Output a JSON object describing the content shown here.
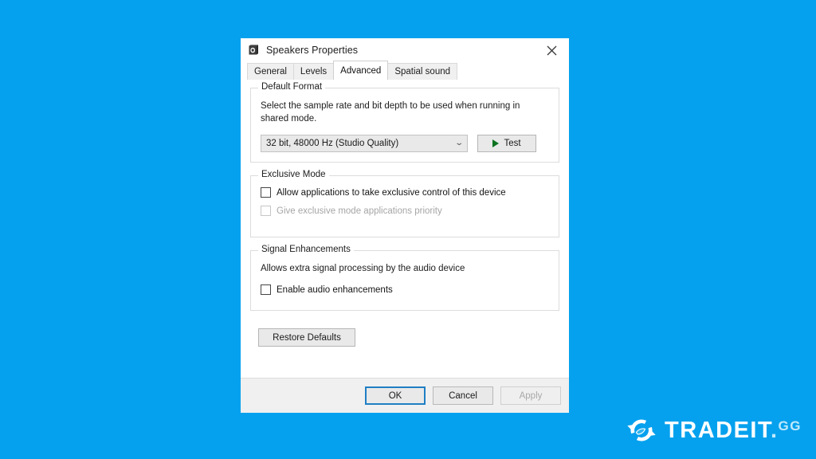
{
  "background_color": "#06a1ee",
  "dialog": {
    "titlebar": {
      "icon": "speaker-icon",
      "title": "Speakers Properties",
      "close_label": "✕"
    },
    "tabs": [
      {
        "label": "General",
        "active": false
      },
      {
        "label": "Levels",
        "active": false
      },
      {
        "label": "Advanced",
        "active": true
      },
      {
        "label": "Spatial sound",
        "active": false
      }
    ],
    "groups": [
      {
        "id": "default-format",
        "title": "Default Format",
        "description": "Select the sample rate and bit depth to be used when running in shared mode.",
        "combo": {
          "value": "32 bit, 48000 Hz (Studio Quality)",
          "chevron": "⌄"
        },
        "test_button": {
          "label": "Test",
          "icon": "play-icon",
          "icon_color": "#0c7320"
        }
      },
      {
        "id": "exclusive-mode",
        "title": "Exclusive Mode",
        "checkboxes": [
          {
            "label": "Allow applications to take exclusive control of this device",
            "checked": false,
            "disabled": false
          },
          {
            "label": "Give exclusive mode applications priority",
            "checked": false,
            "disabled": true
          }
        ]
      },
      {
        "id": "signal-enhancements",
        "title": "Signal Enhancements",
        "description": "Allows extra signal processing by the audio device",
        "checkboxes": [
          {
            "label": "Enable audio enhancements",
            "checked": false,
            "disabled": false
          }
        ]
      }
    ],
    "restore_button": {
      "label": "Restore Defaults"
    },
    "footer_buttons": [
      {
        "label": "OK",
        "default": true,
        "disabled": false
      },
      {
        "label": "Cancel",
        "default": false,
        "disabled": false
      },
      {
        "label": "Apply",
        "default": false,
        "disabled": true
      }
    ]
  },
  "watermark": {
    "mark_icon": "tradeit-circular-arrow-logo",
    "text_primary": "TRADE",
    "text_secondary": "IT",
    "text_dot": ".",
    "text_tld": "GG",
    "primary_color": "#ffffff",
    "secondary_color": "#bfe9fb"
  }
}
